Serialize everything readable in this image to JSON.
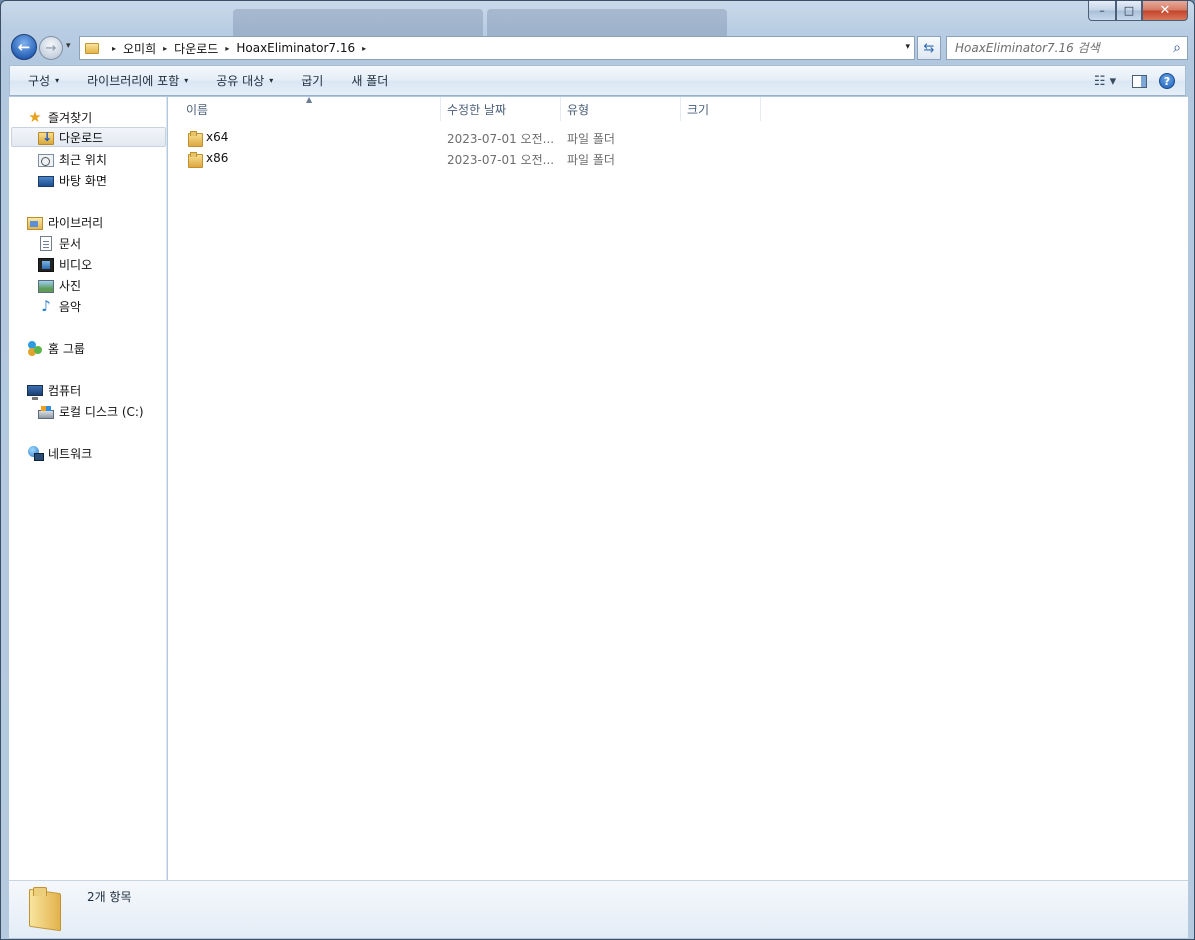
{
  "window": {
    "caption": {
      "minimize": "–",
      "maximize": "□",
      "close": "✕"
    }
  },
  "nav": {
    "back": "←",
    "forward": "→",
    "history": "▾"
  },
  "address": {
    "crumbs": [
      "오미희",
      "다운로드",
      "HoaxEliminator7.16"
    ],
    "separator": "▸",
    "dropdown": "▾"
  },
  "refresh": "⇆",
  "search": {
    "placeholder": "HoaxEliminator7.16 검색",
    "icon": "⌕"
  },
  "toolbar": {
    "organize": "구성",
    "include_library": "라이브러리에 포함",
    "share": "공유 대상",
    "burn": "굽기",
    "new_folder": "새 폴더",
    "arrow": "▾",
    "view_icon": "☷ ▾",
    "help": "?"
  },
  "navpane": {
    "favorites": {
      "label": "즐겨찾기",
      "items": [
        "다운로드",
        "최근 위치",
        "바탕 화면"
      ]
    },
    "libraries": {
      "label": "라이브러리",
      "items": [
        "문서",
        "비디오",
        "사진",
        "음악"
      ]
    },
    "homegroup": "홈 그룹",
    "computer": {
      "label": "컴퓨터",
      "items": [
        "로컬 디스크 (C:)"
      ]
    },
    "network": "네트워크"
  },
  "columns": {
    "name": "이름",
    "date": "수정한 날짜",
    "type": "유형",
    "size": "크기",
    "sort_arrow": "▲"
  },
  "files": [
    {
      "name": "x64",
      "date": "2023-07-01 오전...",
      "type": "파일 폴더"
    },
    {
      "name": "x86",
      "date": "2023-07-01 오전...",
      "type": "파일 폴더"
    }
  ],
  "status": {
    "count": "2개 항목"
  }
}
